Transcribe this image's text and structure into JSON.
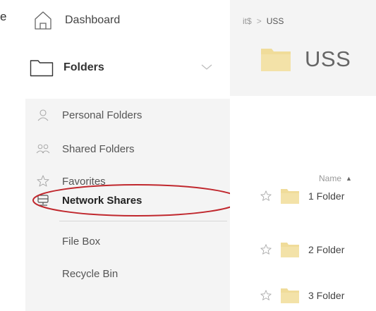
{
  "fragment": "e",
  "sidebar": {
    "dashboard": {
      "label": "Dashboard",
      "icon": "home-icon"
    },
    "folders": {
      "label": "Folders",
      "icon": "folder-outline-icon",
      "expand_icon": "chevron-down-icon"
    },
    "sub_items": [
      {
        "label": "Personal Folders",
        "icon": "person-icon"
      },
      {
        "label": "Shared Folders",
        "icon": "people-icon"
      },
      {
        "label": "Favorites",
        "icon": "star-icon"
      },
      {
        "label": "Network Shares",
        "icon": "network-drive-icon"
      },
      {
        "label": "File Box",
        "icon": ""
      },
      {
        "label": "Recycle Bin",
        "icon": ""
      }
    ],
    "highlight_color": "#c0272d"
  },
  "content": {
    "breadcrumb": {
      "root": "it$",
      "separator": ">",
      "current": "USS"
    },
    "title": "USS",
    "column_header": {
      "label": "Name",
      "sort_indicator": "▲"
    },
    "rows": [
      {
        "name": "1 Folder"
      },
      {
        "name": "2 Folder"
      },
      {
        "name": "3 Folder"
      }
    ],
    "folder_color": "#f0dc9a"
  }
}
